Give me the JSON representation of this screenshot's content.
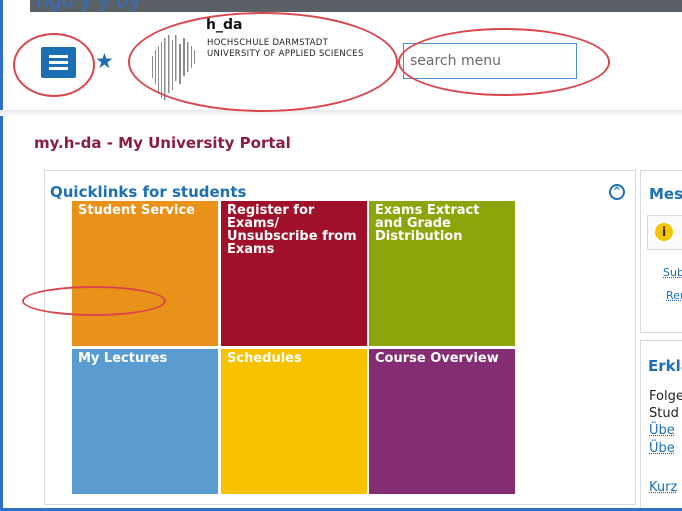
{
  "browser": {
    "title_fragment": "ngo     y   y   oy"
  },
  "header": {
    "menu_icon": "hamburger-icon",
    "favorite_icon": "star-icon",
    "logo": {
      "short": "h_da",
      "line1": "HOCHSCHULE DARMSTADT",
      "line2": "UNIVERSITY OF APPLIED SCIENCES"
    },
    "search": {
      "placeholder": "search menu",
      "value": ""
    }
  },
  "page": {
    "title": "my.h-da - My University Portal"
  },
  "quicklinks": {
    "title": "Quicklinks for students",
    "collapse_icon": "chevron-up-icon",
    "tiles": [
      {
        "label": "Student Service",
        "color": "#e8921a"
      },
      {
        "label": "Register for Exams/ Unsubscribe from Exams",
        "color": "#a1102b"
      },
      {
        "label": "Exams Extract and Grade Distribution",
        "color": "#8aa60b"
      },
      {
        "label": "My Lectures",
        "color": "#5a9bd0"
      },
      {
        "label": "Schedules",
        "color": "#f7c300"
      },
      {
        "label": "Course Overview",
        "color": "#842d73"
      }
    ]
  },
  "messages": {
    "title": "Mes",
    "info_icon": "info-icon",
    "links": [
      "Sub",
      "Rer"
    ]
  },
  "explanations": {
    "title": "Erklä",
    "lines": [
      "Folge",
      "Stud"
    ],
    "links": [
      "Übe",
      "Übe",
      "Kurz"
    ]
  },
  "colors": {
    "accent": "#1c6fb5",
    "title": "#8a1e3e",
    "annotation": "#d9474c"
  }
}
